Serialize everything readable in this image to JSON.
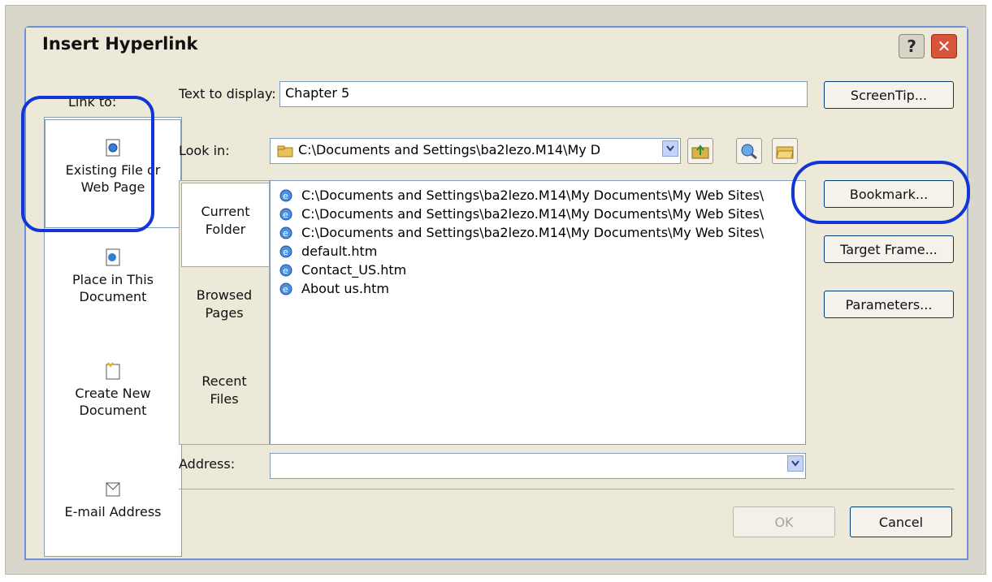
{
  "dialog": {
    "title": "Insert Hyperlink",
    "help_label": "?",
    "close_label": "✕"
  },
  "link_to": {
    "header": "Link to:",
    "items": [
      {
        "label_line1": "Existing File or",
        "label_line2": "Web Page",
        "icon": "web-page-icon",
        "selected": true
      },
      {
        "label_line1": "Place in This",
        "label_line2": "Document",
        "icon": "document-place-icon"
      },
      {
        "label_line1": "Create New",
        "label_line2": "Document",
        "icon": "new-document-icon"
      },
      {
        "label_line1": "E-mail Address",
        "label_line2": "",
        "icon": "email-icon"
      }
    ]
  },
  "text_to_display": {
    "label": "Text to display:",
    "value": "Chapter 5"
  },
  "look_in": {
    "label": "Look in:",
    "value": "C:\\Documents and Settings\\ba2lezo.M14\\My D"
  },
  "tabs": [
    {
      "line1": "Current",
      "line2": "Folder",
      "active": true
    },
    {
      "line1": "Browsed",
      "line2": "Pages"
    },
    {
      "line1": "Recent",
      "line2": "Files"
    }
  ],
  "files": [
    "C:\\Documents and Settings\\ba2lezo.M14\\My Documents\\My Web Sites\\",
    "C:\\Documents and Settings\\ba2lezo.M14\\My Documents\\My Web Sites\\",
    "C:\\Documents and Settings\\ba2lezo.M14\\My Documents\\My Web Sites\\",
    "default.htm",
    "Contact_US.htm",
    "About us.htm"
  ],
  "address": {
    "label": "Address:",
    "value": ""
  },
  "buttons": {
    "screentip": "ScreenTip...",
    "bookmark": "Bookmark...",
    "target_frame": "Target Frame...",
    "parameters": "Parameters...",
    "ok": "OK",
    "cancel": "Cancel"
  },
  "colors": {
    "highlight": "#1236d6",
    "titlebar_close": "#d8553c",
    "dialog_bg": "#ece9d8"
  }
}
